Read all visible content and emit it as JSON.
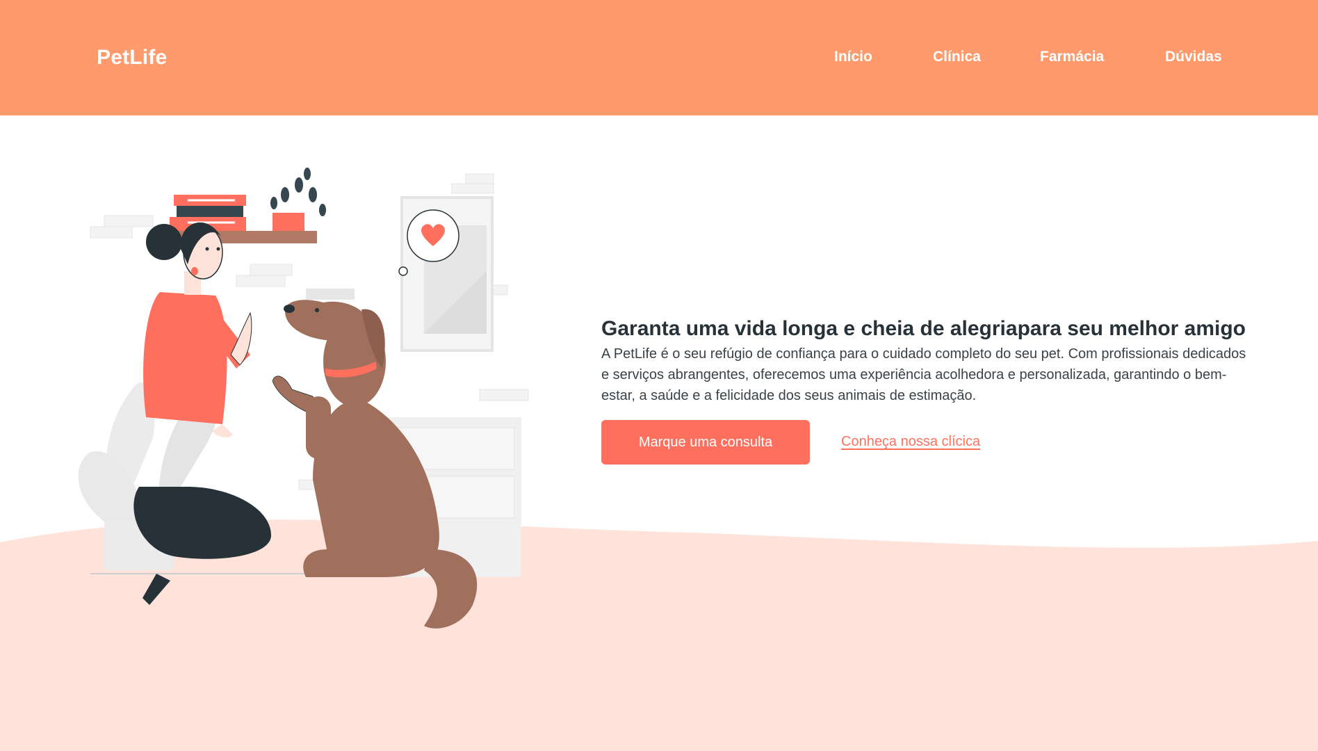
{
  "header": {
    "logo": "PetLife",
    "nav": [
      {
        "label": "Início"
      },
      {
        "label": "Clínica"
      },
      {
        "label": "Farmácia"
      },
      {
        "label": "Dúvidas"
      }
    ]
  },
  "hero": {
    "title": "Garanta uma vida longa e cheia de alegriapara seu melhor amigo",
    "description": "A PetLife é o seu refúgio de confiança para o cuidado completo do seu pet. Com profissionais dedicados e serviços abrangentes, oferecemos uma experiência acolhedora e personalizada, garantindo o bem-estar, a saúde e a felicidade dos seus animais de estimação.",
    "cta_label": "Marque uma consulta",
    "link_label": "Conheça nossa clícica"
  },
  "illustration": {
    "icon": "woman-and-dog-high-five-illustration"
  },
  "colors": {
    "header": "#ff9a6c",
    "accent": "#ff6f5e",
    "wave": "#ffe3da",
    "text": "#263238",
    "dog": "#a0705d"
  }
}
